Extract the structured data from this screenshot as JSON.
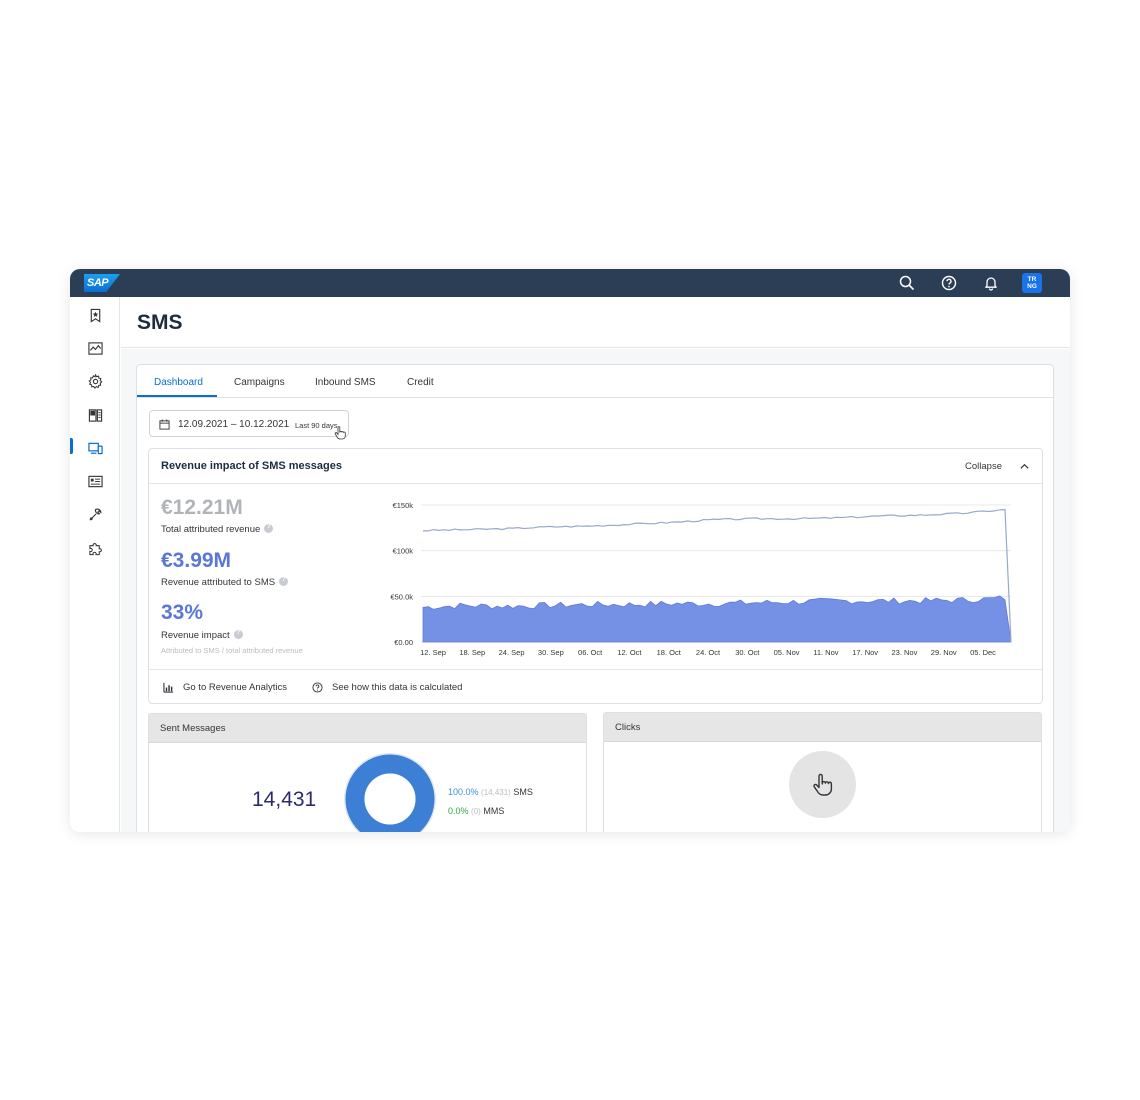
{
  "shell": {
    "logo": "SAP",
    "avatar_line1": "TR",
    "avatar_line2": "NG",
    "icons": [
      "search-icon",
      "help-icon",
      "bell-icon"
    ]
  },
  "sidenav": {
    "items": [
      "favorites-icon",
      "analytics-icon",
      "settings-icon",
      "content-icon",
      "channels-icon",
      "contacts-icon",
      "tools-icon",
      "extensions-icon"
    ],
    "active_index": 4
  },
  "page": {
    "title": "SMS"
  },
  "tabs": [
    {
      "label": "Dashboard",
      "active": true
    },
    {
      "label": "Campaigns",
      "active": false
    },
    {
      "label": "Inbound SMS",
      "active": false
    },
    {
      "label": "Credit",
      "active": false
    }
  ],
  "date_filter": {
    "range": "12.09.2021 – 10.12.2021",
    "hint": "Last 90 days"
  },
  "revenue": {
    "title": "Revenue impact of SMS messages",
    "collapse_label": "Collapse",
    "kpis": [
      {
        "value": "€12.21M",
        "label": "Total attributed revenue",
        "color": "#b0b4b9"
      },
      {
        "value": "€3.99M",
        "label": "Revenue attributed to SMS",
        "color": "#5a76d6"
      },
      {
        "value": "33%",
        "label": "Revenue impact",
        "color": "#5a76d6"
      }
    ],
    "kpi_note": "Attributed to SMS / total attributed revenue",
    "footer_links": [
      {
        "label": "Go to Revenue Analytics",
        "icon": "bar-chart-icon"
      },
      {
        "label": "See how this data is calculated",
        "icon": "help-icon"
      }
    ]
  },
  "chart_data": {
    "type": "area",
    "x": [
      "12. Sep",
      "18. Sep",
      "24. Sep",
      "30. Sep",
      "06. Oct",
      "12. Oct",
      "18. Oct",
      "24. Oct",
      "30. Oct",
      "05. Nov",
      "11. Nov",
      "17. Nov",
      "23. Nov",
      "29. Nov",
      "05. Dec"
    ],
    "y_ticks": [
      "€150k",
      "€100k",
      "€50.0k",
      "€0.00"
    ],
    "ylim": [
      0,
      150000
    ],
    "series": [
      {
        "values": [
          122000,
          123000,
          124000,
          126000,
          127000,
          129000,
          131000,
          134000,
          135000,
          135000,
          136000,
          138000,
          139000,
          141000,
          145000
        ],
        "color": "#9aa9c7",
        "style": "line"
      },
      {
        "values": [
          38000,
          40000,
          39000,
          40000,
          41000,
          41000,
          42000,
          42000,
          43000,
          44000,
          45000,
          45000,
          45000,
          46000,
          48000
        ],
        "color": "#7591e6",
        "style": "area"
      }
    ],
    "grid": true,
    "legend": "none"
  },
  "sent_messages": {
    "title": "Sent Messages",
    "total": "14,431",
    "donut": {
      "sms_fraction": 1.0,
      "sms_color": "#3c7fd4",
      "mms_color": "#36a44a"
    },
    "legend": [
      {
        "pct": "100.0%",
        "count": "(14,431)",
        "label": "SMS"
      },
      {
        "pct": "0.0%",
        "count": "(0)",
        "label": "MMS"
      }
    ]
  },
  "clicks": {
    "title": "Clicks",
    "icon": "pointer-hand-icon"
  }
}
